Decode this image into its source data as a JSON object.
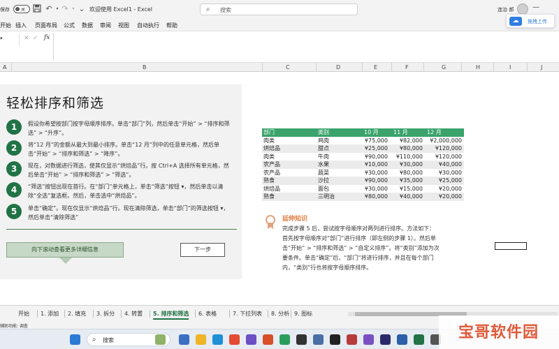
{
  "titlebar": {
    "autosave_label": "保存",
    "autosave_state": "关",
    "doc_title": "欢迎使用 Excel1 - Excel",
    "search_placeholder": "搜索",
    "user_name": "连治 郝",
    "minimize": "—",
    "restore": "▢",
    "close": "✕"
  },
  "menubar": {
    "items": [
      "开始",
      "插入",
      "页面布局",
      "公式",
      "数据",
      "审阅",
      "视图",
      "自动执行",
      "帮助"
    ],
    "upload_label": "拖拽上传",
    "share_label": "共享"
  },
  "formulabar": {
    "name_box": "",
    "fx_label": "fx",
    "value": ""
  },
  "columns": [
    "A",
    "B",
    "C",
    "D",
    "E",
    "F",
    "G",
    "H",
    "I",
    "J"
  ],
  "tutorial": {
    "title": "轻松排序和筛选",
    "steps": [
      {
        "num": "1",
        "text": "假设你希望按部门按字母顺序排序。单击“部门”列，然后单击“开始” > “排序和筛选” > “升序”。"
      },
      {
        "num": "2",
        "text": "将“12 月”的金额从最大到最小排序。单击“12 月”列中的任意单元格，然后单击“开始” > “排序和筛选” > “降序”。"
      },
      {
        "num": "3",
        "text": "现在，对数据进行筛选，使其仅显示“烘焙品”行。按 Ctrl+A 选择所有单元格，然后单击“开始” > “排序和筛选” > “筛选”。"
      },
      {
        "num": "4",
        "text": "“筛选”按钮出现在首行。在“部门”单元格上，单击“筛选”按钮 ▾，然后单击以清除“全选”复选框。然后，单击选中“烘焙品”。"
      },
      {
        "num": "5",
        "text": "单击“确定”。现在仅显示“烘焙品”行。现在清除筛选，单击“部门”的筛选按钮 ▾，然后单击“清除筛选”"
      }
    ],
    "scroll_button": "向下滚动查看更多详细信息",
    "next_button": "下一步"
  },
  "table": {
    "headers": [
      "部门",
      "类别",
      "10 月",
      "11 月",
      "12 月"
    ],
    "rows": [
      [
        "肉类",
        "鸡肉",
        "¥75,000",
        "¥82,000",
        "¥2,000,000"
      ],
      [
        "烘焙品",
        "甜点",
        "¥25,000",
        "¥80,000",
        "¥120,000"
      ],
      [
        "肉类",
        "牛肉",
        "¥90,000",
        "¥110,000",
        "¥120,000"
      ],
      [
        "农产品",
        "水果",
        "¥10,000",
        "¥30,000",
        "¥40,000"
      ],
      [
        "农产品",
        "蔬菜",
        "¥30,000",
        "¥80,000",
        "¥30,000"
      ],
      [
        "熟食",
        "沙拉",
        "¥90,000",
        "¥35,000",
        "¥25,000"
      ],
      [
        "烘焙品",
        "面包",
        "¥30,000",
        "¥15,000",
        "¥20,000"
      ],
      [
        "熟食",
        "三明治",
        "¥80,000",
        "¥40,000",
        "¥20,000"
      ]
    ]
  },
  "tip": {
    "title": "延伸知识",
    "text": "完成步骤 5 后，尝试按字母顺序对两列进行排序。方法如下：首先按字母顺序对“部门”进行排序（即左侧的步骤 1）。然后单击“开始” > “排序和筛选” > “自定义排序”。将“类别”添加为次要条件。单击“确定”后，“部门”将进行排序，并且在每个部门内，“类别”行也将按字母顺序排序。"
  },
  "sheet_tabs": [
    "开始",
    "1. 添加",
    "2. 填充",
    "3. 拆分",
    "4. 转置",
    "5. 排序和筛选",
    "6. 表格",
    "7. 下拉列表",
    "8. 分析",
    "9. 图标"
  ],
  "active_tab": "5. 排序和筛选",
  "status": {
    "text": "辅助功能: 调查"
  },
  "taskbar": {
    "search_label": "搜索"
  },
  "watermark": {
    "text": "宝哥软件园",
    "url": "www.baoge.net"
  },
  "colors": {
    "excel_green": "#217346",
    "table_header": "#3aa36b",
    "tip_orange": "#e07f45"
  }
}
